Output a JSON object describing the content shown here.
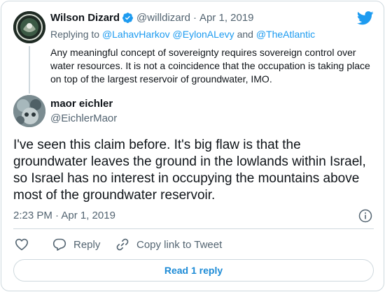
{
  "parent_tweet": {
    "name": "Wilson Dizard",
    "handle": "@willdizard",
    "separator": "·",
    "date": "Apr 1, 2019",
    "replying_prefix": "Replying to",
    "replying_to": [
      "@LahavHarkov",
      "@EylonALevy",
      "and",
      "@TheAtlantic"
    ],
    "text": "Any meaningful concept of sovereignty requires sovereign control over water resources. It is not a coincidence that the occupation is taking place on top of the largest reservoir of groundwater, IMO."
  },
  "main_tweet": {
    "name": "maor eichler",
    "handle": "@EichlerMaor",
    "text": "I've seen this claim before. It's big flaw is that the groundwater leaves the ground in the lowlands within Israel, so Israel has no interest in occupying the mountains above most of the groundwater reservoir.",
    "timestamp": "2:23 PM · Apr 1, 2019"
  },
  "actions": {
    "reply_label": "Reply",
    "copy_link_label": "Copy link to Tweet"
  },
  "read_replies_label": "Read 1 reply",
  "colors": {
    "accent": "#1d9bf0",
    "muted": "#536471",
    "border": "#cfd9de"
  },
  "icons": [
    "twitter-bird-icon",
    "verified-badge-icon",
    "info-icon",
    "heart-icon",
    "reply-icon",
    "link-icon"
  ]
}
